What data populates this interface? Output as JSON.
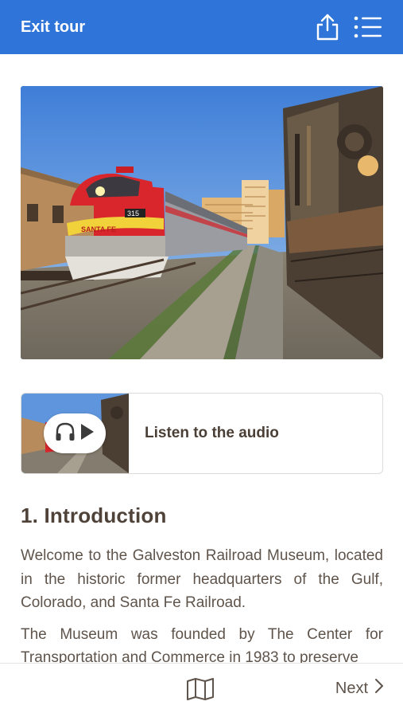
{
  "header": {
    "exit_label": "Exit tour",
    "share_icon": "share-icon",
    "menu_icon": "list-menu-icon",
    "background_color": "#2f74d8"
  },
  "hero_image": {
    "subject": "railroad-museum-locomotives-photo",
    "locomotive_number": "315",
    "locomotive_logo": "SANTA FE"
  },
  "audio": {
    "label": "Listen to the audio",
    "headphones_icon": "headphones-icon",
    "play_icon": "play-icon"
  },
  "section": {
    "title": "1. Introduction",
    "paragraphs": [
      "Welcome to the Galveston Railroad Museum, located in the historic former headquarters of the Gulf, Colorado, and Santa Fe Railroad.",
      "The Museum was founded by The Center for Transportation and Commerce in 1983 to preserve"
    ]
  },
  "footer": {
    "map_icon": "map-icon",
    "next_label": "Next",
    "next_icon": "chevron-right-icon"
  }
}
